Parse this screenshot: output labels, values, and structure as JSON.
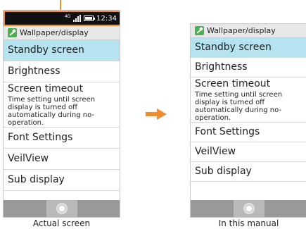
{
  "status_bar": {
    "network": "4G",
    "time": "12:34"
  },
  "screen": {
    "title": "Wallpaper/display",
    "items": [
      {
        "label": "Standby screen",
        "selected": true
      },
      {
        "label": "Brightness"
      },
      {
        "label": "Screen timeout",
        "description": "Time setting until screen display is turned off automatically during no-operation."
      },
      {
        "label": "Font Settings"
      },
      {
        "label": "VeilView"
      },
      {
        "label": "Sub display"
      }
    ]
  },
  "captions": {
    "left": "Actual screen",
    "right": "In this manual"
  },
  "colors": {
    "highlight": "#f08c2a",
    "selected_row": "#b5e3ef",
    "nav_bar": "#999999"
  },
  "icons": {
    "app": "wallpaper-app-icon",
    "home": "home-button-icon",
    "arrow": "right-arrow-icon"
  }
}
